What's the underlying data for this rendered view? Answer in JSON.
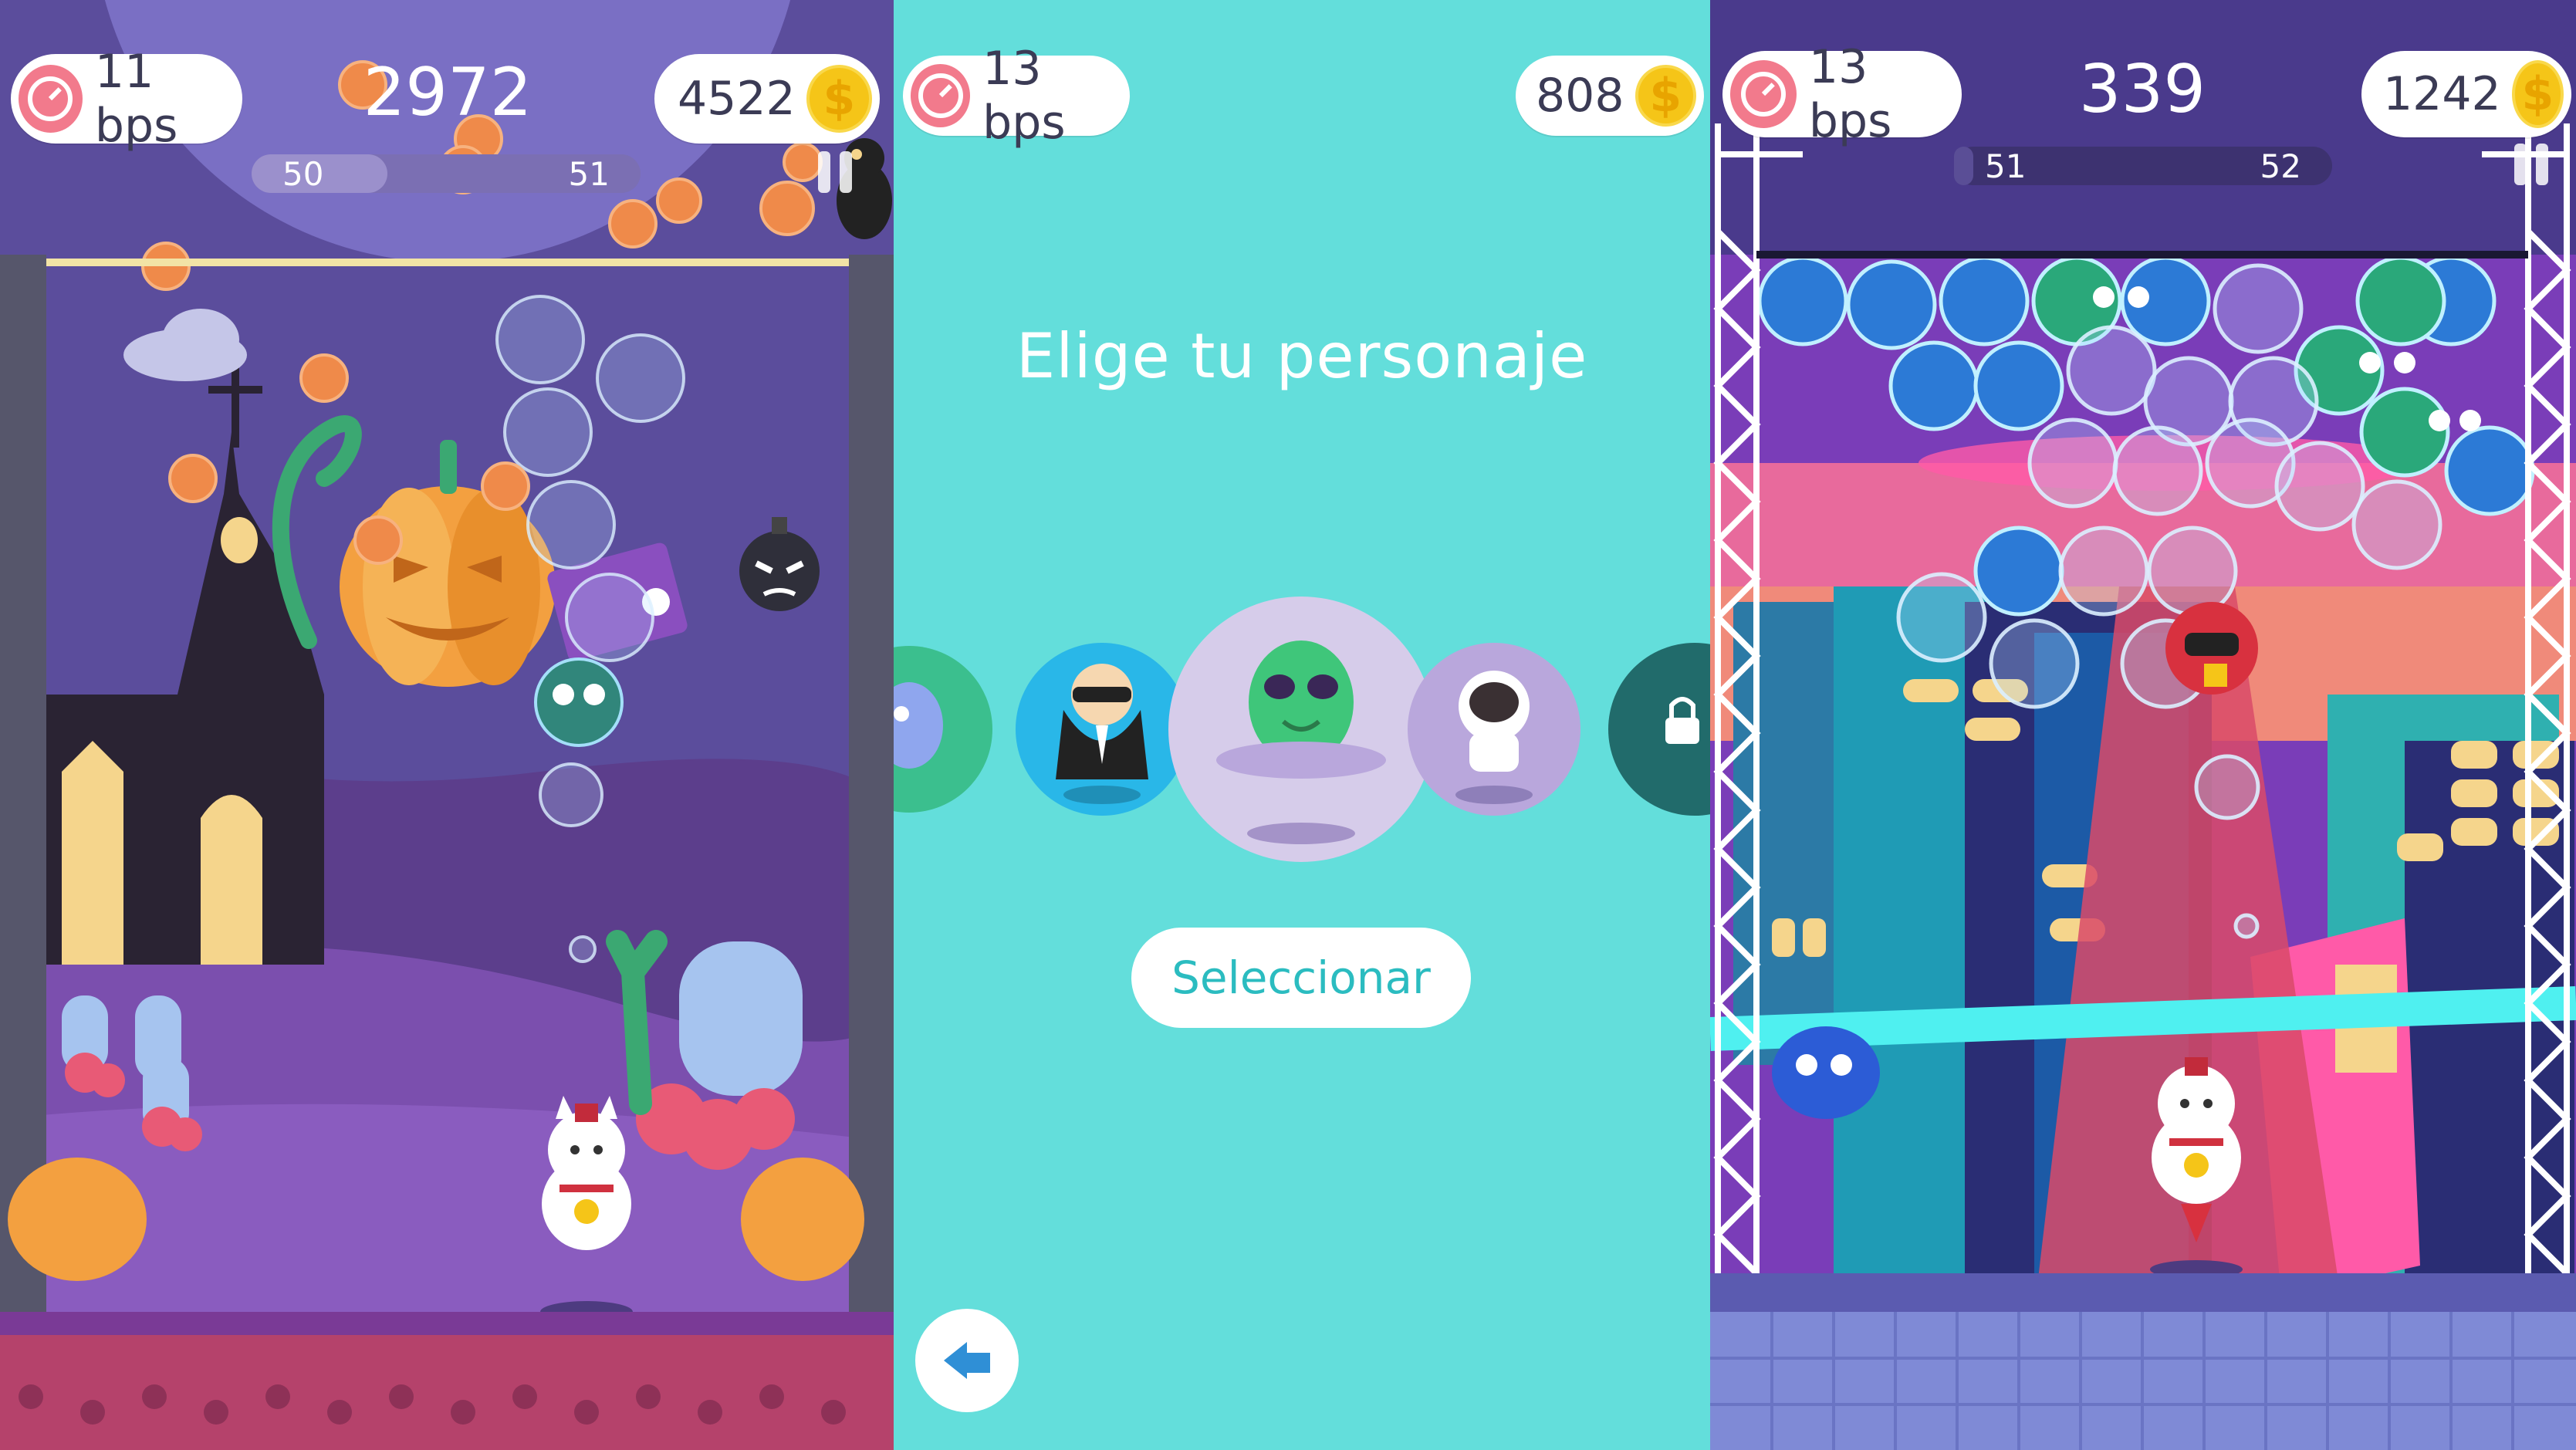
{
  "left_panel": {
    "bps_label": "11 bps",
    "score": "2972",
    "coins": "4522",
    "coin_symbol": "$",
    "level_current": "50",
    "level_next": "51",
    "level_progress": 0.35
  },
  "middle_panel": {
    "bps_label": "13 bps",
    "coins": "808",
    "coin_symbol": "$",
    "heading": "Elige tu personaje",
    "select_button": "Seleccionar",
    "characters": [
      "robot-blue",
      "agent",
      "alien",
      "astronaut",
      "locked-character"
    ],
    "selected_character": "alien"
  },
  "right_panel": {
    "bps_label": "13 bps",
    "score": "339",
    "coins": "1242",
    "coin_symbol": "$",
    "level_current": "51",
    "level_next": "52",
    "level_progress": 0.05
  },
  "colors": {
    "halloween_bg": "#5b4d9c",
    "select_bg": "#63dedb",
    "city_bg": "#4a3a8c",
    "coin": "#f5c518",
    "speed_icon": "#f27a8c"
  }
}
